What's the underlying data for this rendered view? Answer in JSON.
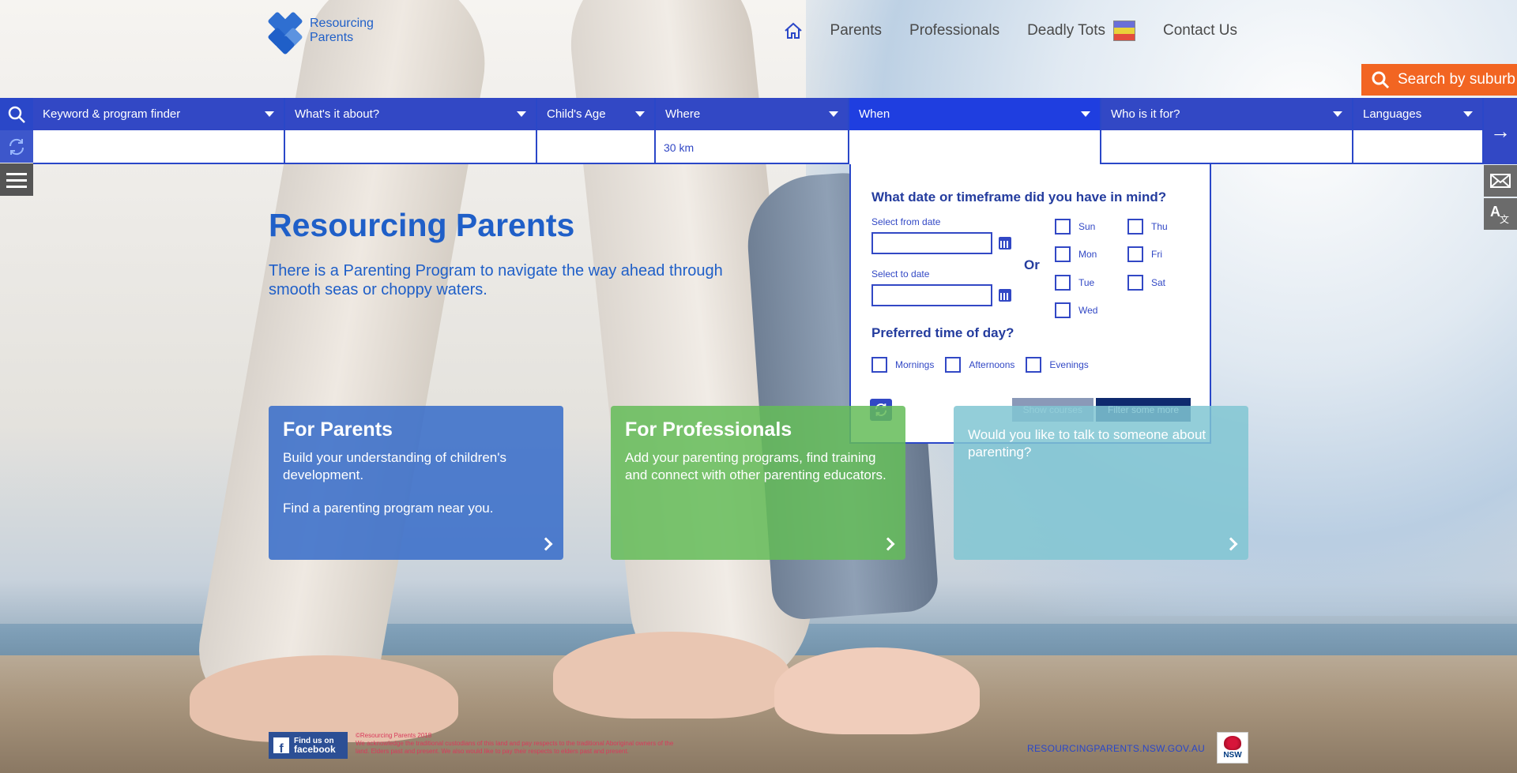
{
  "header": {
    "logo_line1": "Resourcing",
    "logo_line2": "Parents",
    "nav": [
      "Parents",
      "Professionals",
      "Deadly Tots",
      "Contact Us"
    ],
    "search_suburb": "Search by suburb"
  },
  "filters": [
    {
      "label": "Keyword & program finder",
      "value": ""
    },
    {
      "label": "What's it about?",
      "value": ""
    },
    {
      "label": "Child's Age",
      "value": ""
    },
    {
      "label": "Where",
      "value": "30 km"
    },
    {
      "label": "When",
      "value": ""
    },
    {
      "label": "Who is it for?",
      "value": ""
    },
    {
      "label": "Languages",
      "value": ""
    }
  ],
  "when_panel": {
    "question": "What date or timeframe did you have in mind?",
    "from_label": "Select from date",
    "to_label": "Select to date",
    "or": "Or",
    "days": [
      "Sun",
      "Thu",
      "Mon",
      "Fri",
      "Tue",
      "Sat",
      "Wed"
    ],
    "time_question": "Preferred time of day?",
    "times": [
      "Mornings",
      "Afternoons",
      "Evenings"
    ],
    "show_courses": "Show courses",
    "filter_more": "Filter some more"
  },
  "hero": {
    "title": "Resourcing Parents",
    "subtitle": "There is a Parenting Program to navigate the way ahead through smooth seas or choppy waters."
  },
  "cards": [
    {
      "title": "For Parents",
      "text1": "Build your understanding of children's development.",
      "text2": "Find a parenting program near you."
    },
    {
      "title": "For Professionals",
      "text1": "Add your parenting programs, find training and connect with other parenting educators.",
      "text2": ""
    },
    {
      "title": "",
      "text1": "Would you like to talk to someone about parenting?",
      "text2": ""
    }
  ],
  "footer": {
    "fb_line1": "Find us on",
    "fb_line2": "facebook",
    "copyright": "©Resourcing Parents 2018",
    "acknowledgement": "We acknowledge the traditional custodians of this land and pay respects to the traditional Aboriginal owners of the land. Elders past and present. We also would like to pay their respects to elders past and present.",
    "site_url": "RESOURCINGPARENTS.NSW.GOV.AU",
    "nsw": "NSW"
  },
  "colors": {
    "brand_blue": "#3248c5",
    "accent_orange": "#f26522",
    "parents_card": "#3a6ec9",
    "pros_card": "#64bc58",
    "talk_card": "#80c6d2"
  }
}
